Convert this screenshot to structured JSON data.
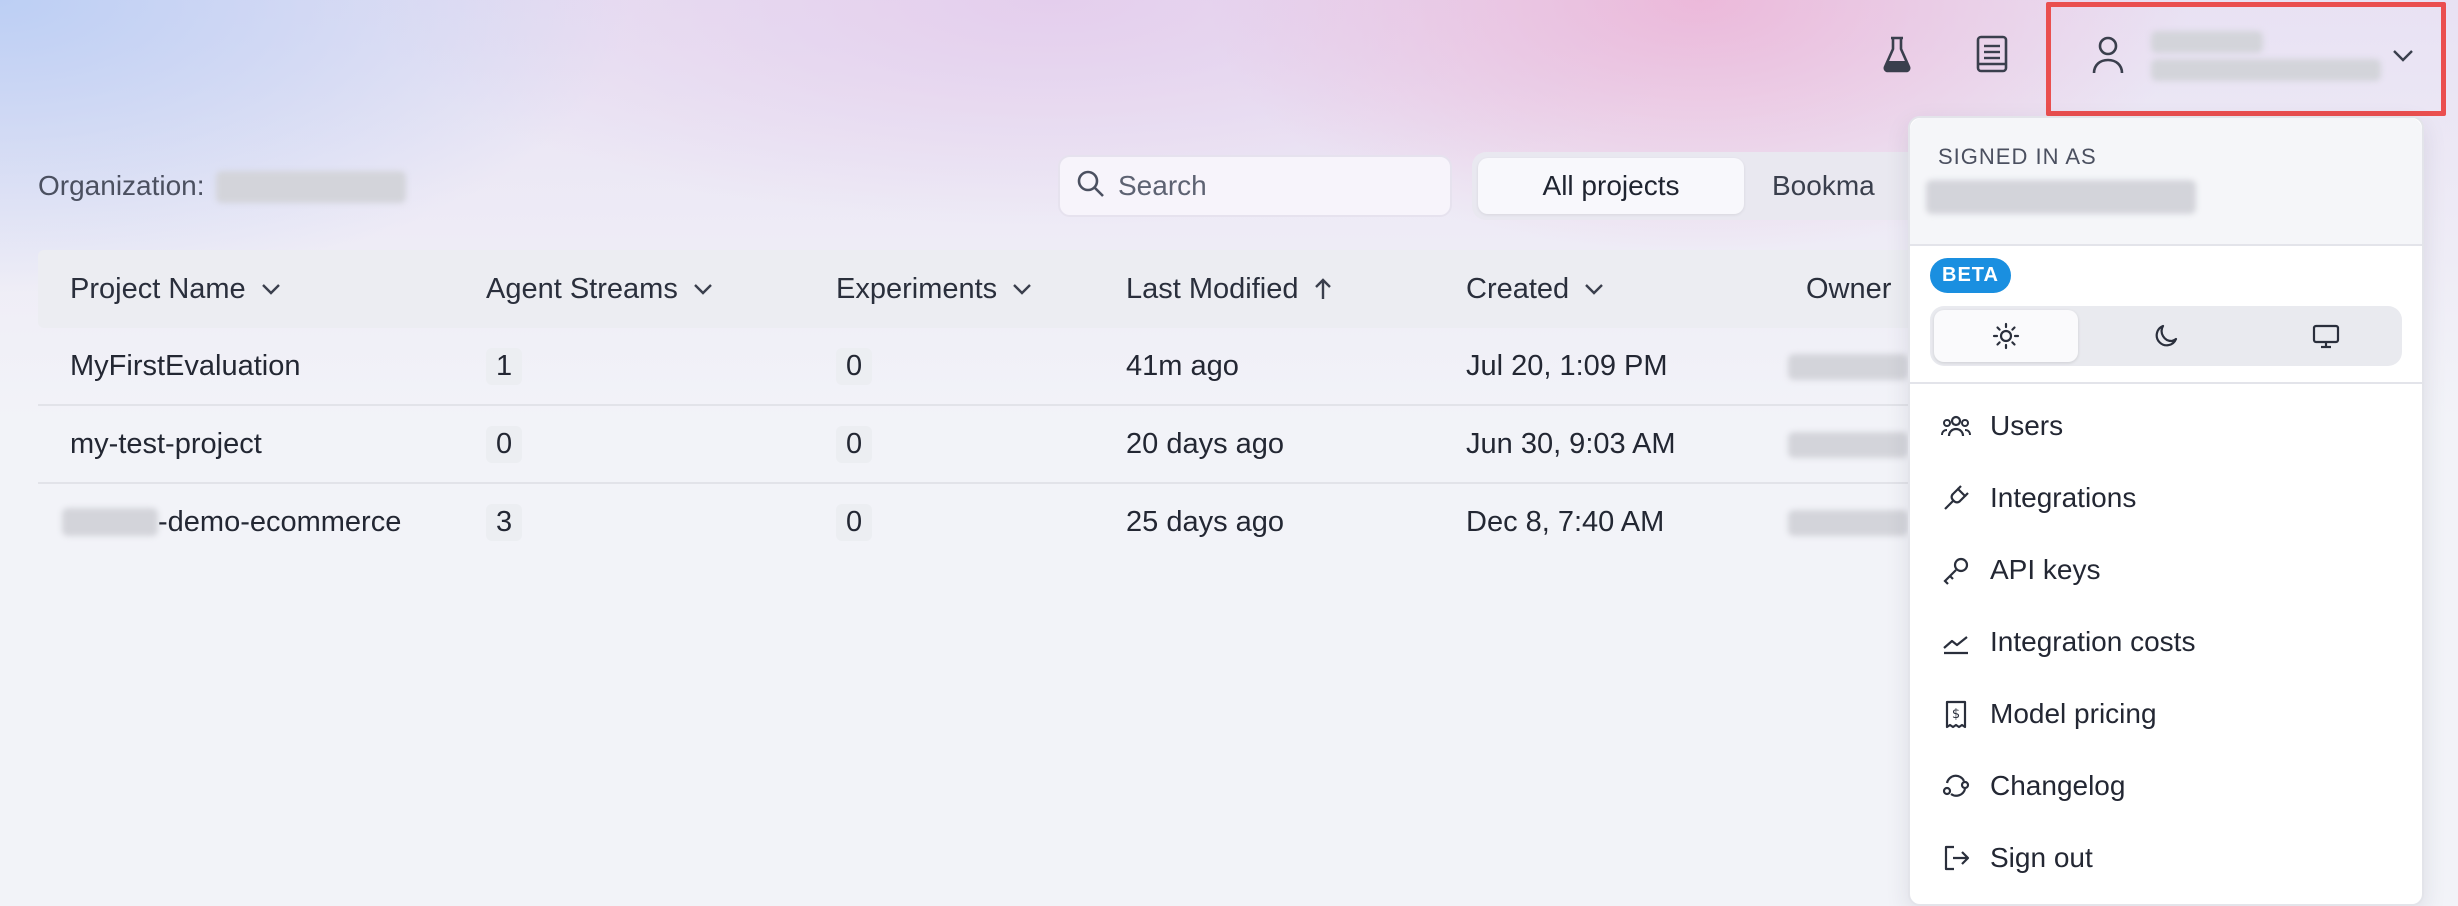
{
  "header": {
    "icons": [
      "flask-icon",
      "book-icon",
      "user-icon",
      "chevron-down-icon"
    ]
  },
  "org": {
    "label": "Organization:"
  },
  "search": {
    "placeholder": "Search",
    "value": ""
  },
  "tabs": [
    {
      "label": "All projects",
      "active": true
    },
    {
      "label": "Bookma",
      "active": false
    }
  ],
  "table": {
    "columns": [
      "Project Name",
      "Agent Streams",
      "Experiments",
      "Last Modified",
      "Created",
      "Owner"
    ],
    "rows": [
      {
        "name": "MyFirstEvaluation",
        "streams": "1",
        "experiments": "0",
        "modified": "41m ago",
        "created": "Jul 20, 1:09 PM"
      },
      {
        "name": "my-test-project",
        "streams": "0",
        "experiments": "0",
        "modified": "20 days ago",
        "created": "Jun 30, 9:03 AM"
      },
      {
        "name": "-demo-ecommerce",
        "streams": "3",
        "experiments": "0",
        "modified": "25 days ago",
        "created": "Dec 8, 7:40 AM"
      }
    ]
  },
  "menu": {
    "signed_in_label": "SIGNED IN AS",
    "beta_label": "BETA",
    "theme_options": [
      "sun-icon",
      "moon-icon",
      "monitor-icon"
    ],
    "items": [
      {
        "label": "Users",
        "icon": "users-icon"
      },
      {
        "label": "Integrations",
        "icon": "plug-icon"
      },
      {
        "label": "API keys",
        "icon": "key-icon"
      },
      {
        "label": "Integration costs",
        "icon": "trend-chart-icon"
      },
      {
        "label": "Model pricing",
        "icon": "receipt-icon"
      },
      {
        "label": "Changelog",
        "icon": "changelog-icon"
      },
      {
        "label": "Sign out",
        "icon": "sign-out-icon"
      }
    ]
  },
  "colors": {
    "highlight": "#ea4f4f",
    "beta": "#1a8fe0"
  }
}
